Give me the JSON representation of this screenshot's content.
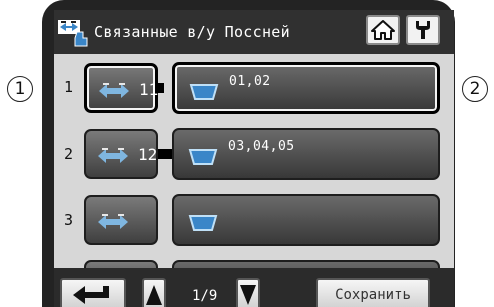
{
  "callouts": [
    "1",
    "2"
  ],
  "header": {
    "title": "Связанные в/у Поссней",
    "home_icon": "home-icon",
    "settings_icon": "wrench-icon"
  },
  "rows": [
    {
      "number": "1",
      "unit": "11",
      "groups": "01,02",
      "selected": true
    },
    {
      "number": "2",
      "unit": "12",
      "groups": "03,04,05",
      "selected": false
    },
    {
      "number": "3",
      "unit": "",
      "groups": "",
      "selected": false
    }
  ],
  "footer": {
    "back_icon": "return-arrow-icon",
    "page": "1/9",
    "save_label": "Сохранить"
  },
  "colors": {
    "frame": "#232323",
    "screen": "#d7d7d7",
    "button_light": "#f2f2f2",
    "icon_blue": "#3a86c8"
  }
}
